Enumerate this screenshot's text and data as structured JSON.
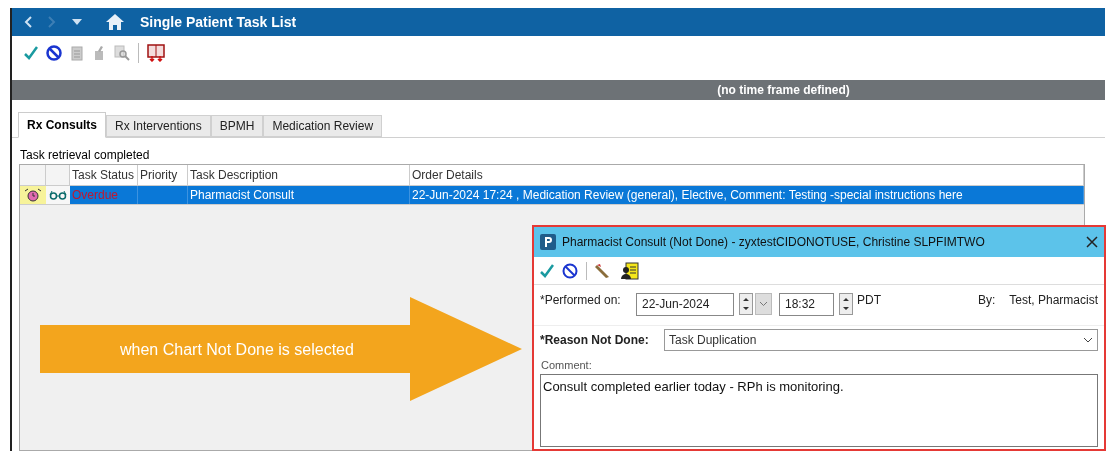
{
  "window": {
    "title": "Single Patient Task List"
  },
  "time_frame": "(no time frame defined)",
  "tabs": [
    {
      "label": "Rx Consults",
      "selected": true
    },
    {
      "label": "Rx Interventions",
      "selected": false
    },
    {
      "label": "BPMH",
      "selected": false
    },
    {
      "label": "Medication Review",
      "selected": false
    }
  ],
  "status_message": "Task retrieval completed",
  "table": {
    "columns": [
      "Task Status",
      "Priority",
      "Task Description",
      "Order Details"
    ],
    "rows": [
      {
        "task_status": "Overdue",
        "priority": "",
        "task_description": "Pharmacist Consult",
        "order_details": "22-Jun-2024 17:24 , Medication Review (general), Elective, Comment: Testing -special instructions here",
        "selected": true
      }
    ]
  },
  "callout": {
    "text": "when Chart Not Done is selected"
  },
  "dialog": {
    "title": "Pharmacist Consult (Not Done) - zyxtestCIDONOTUSE, Christine SLPFIMTWO",
    "performed_on_label": "*Performed on:",
    "date": "22-Jun-2024",
    "time": "18:32",
    "timezone": "PDT",
    "by_label": "By:",
    "by_value": "Test, Pharmacist",
    "reason_label": "*Reason Not Done:",
    "reason_value": "Task Duplication",
    "comment_label": "Comment:",
    "comment_value": "Consult completed earlier today - RPh is monitoring."
  }
}
